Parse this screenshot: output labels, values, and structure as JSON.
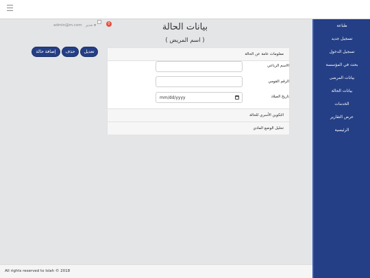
{
  "sidebar": {
    "items": [
      {
        "label": "طباعة"
      },
      {
        "label": "تسجيل جديد"
      },
      {
        "label": "تسجيل الدخول"
      },
      {
        "label": "بحث في المؤسسة"
      },
      {
        "label": "بيانات المرضى"
      },
      {
        "label": "بيانات الحالة"
      },
      {
        "label": "الخدمات"
      },
      {
        "label": "عرض التقارير"
      },
      {
        "label": "الرئيسية"
      }
    ]
  },
  "header": {
    "notification_count": "0",
    "user_role": "مدير",
    "user_email": "admin@m.com"
  },
  "page": {
    "title": "بيانات الحالة",
    "subtitle": "( اسم المريض )"
  },
  "actions": {
    "edit": "تعديل",
    "delete": "حذف",
    "add": "إضافة حالة"
  },
  "form": {
    "header": "معلومات عامة عن الحالة",
    "full_name_label": "الاسم الرباعي",
    "full_name_value": "",
    "national_id_label": "الرقم القومي",
    "national_id_value": "",
    "birth_date_label": "تاريخ الميلاد",
    "birth_date_placeholder": "mm/dd/yyyy"
  },
  "sections": {
    "family": "التكوين الأسري للحالة",
    "financial": "تحليل الوضع المادي"
  },
  "footer": {
    "text": "All rights reserved to Islah © 2018"
  },
  "colors": {
    "sidebar": "#243f86",
    "primary_button": "#243f86",
    "notification": "#e74c3c"
  },
  "icons": {
    "menu": "hamburger-icon",
    "calendar": "calendar-icon",
    "user_image": "broken-image-icon"
  }
}
